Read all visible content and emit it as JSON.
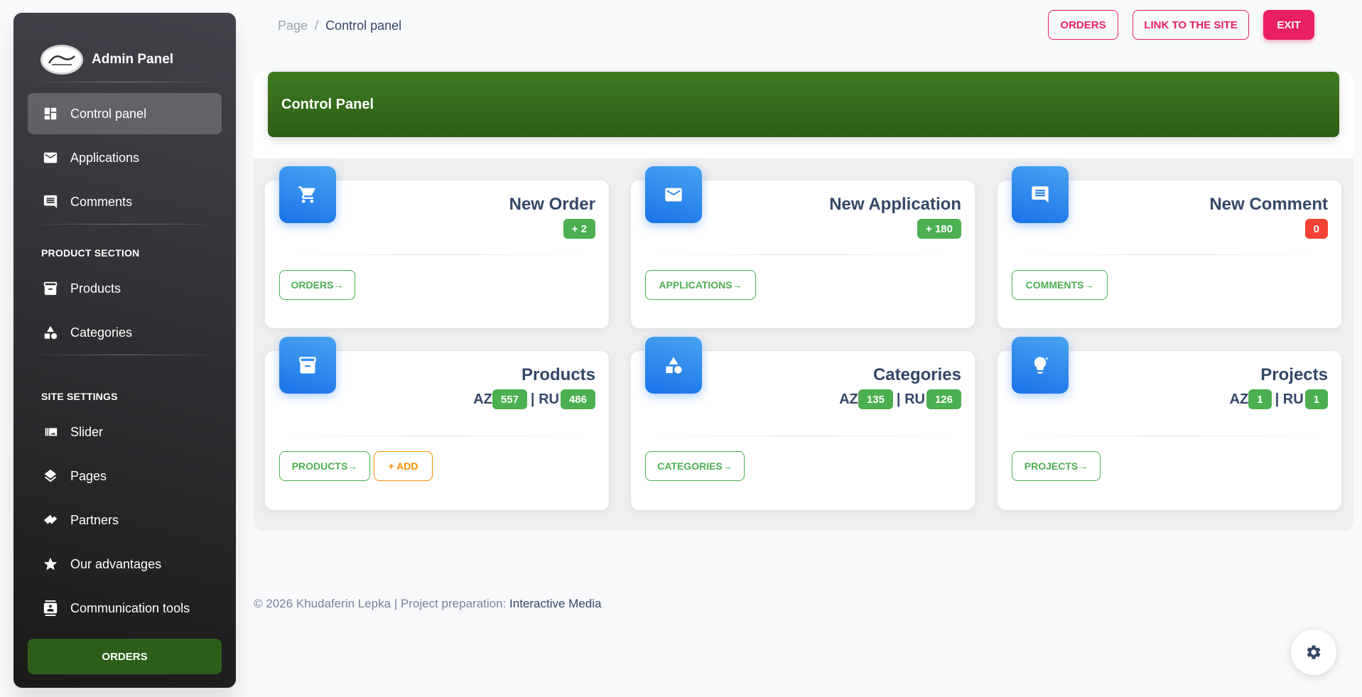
{
  "sidebar": {
    "brand": "Admin Panel",
    "items": [
      {
        "label": "Control panel",
        "icon": "dashboard-icon"
      },
      {
        "label": "Applications",
        "icon": "mail-icon"
      },
      {
        "label": "Comments",
        "icon": "comment-icon"
      },
      {
        "label": "Products",
        "icon": "archive-icon"
      },
      {
        "label": "Categories",
        "icon": "category-icon"
      },
      {
        "label": "Slider",
        "icon": "slider-icon"
      },
      {
        "label": "Pages",
        "icon": "layers-icon"
      },
      {
        "label": "Partners",
        "icon": "handshake-icon"
      },
      {
        "label": "Our advantages",
        "icon": "star-icon"
      },
      {
        "label": "Communication tools",
        "icon": "contact-icon"
      }
    ],
    "sections": [
      "PRODUCT SECTION",
      "SITE SETTINGS"
    ],
    "bottom_button": "ORDERS"
  },
  "breadcrumb": {
    "root": "Page",
    "separator": "/",
    "current": "Control panel"
  },
  "topbar": {
    "orders": "ORDERS",
    "link_site": "LINK TO THE SITE",
    "exit": "EXIT"
  },
  "header": {
    "title": "Control Panel"
  },
  "cards": [
    {
      "title": "New Order",
      "badge": "+ 2",
      "button": "ORDERS→",
      "icon": "cart-icon"
    },
    {
      "title": "New Application",
      "badge": "+ 180",
      "button": "APPLICATIONS→",
      "icon": "mail-icon"
    },
    {
      "title": "New Comment",
      "badge": "0",
      "button": "COMMENTS→",
      "icon": "comment-icon"
    },
    {
      "title": "Products",
      "az_label": "AZ",
      "az": "557",
      "sep": "| RU",
      "ru": "486",
      "button": "PRODUCTS→",
      "button2": "+ ADD",
      "icon": "archive-icon"
    },
    {
      "title": "Categories",
      "az_label": "AZ",
      "az": "135",
      "sep": "| RU",
      "ru": "126",
      "button": "CATEGORIES→",
      "icon": "category-icon"
    },
    {
      "title": "Projects",
      "az_label": "AZ",
      "az": "1",
      "sep": "| RU",
      "ru": "1",
      "button": "PROJECTS→",
      "icon": "lightbulb-icon"
    }
  ],
  "footer": {
    "text": "© 2026 Khudaferin Lepka | Project preparation: ",
    "link": "Interactive Media"
  },
  "colors": {
    "accent": "#e91e63",
    "success": "#4caf50",
    "danger": "#f44335",
    "header": "#3f7a22",
    "icon_bg": "#1a73e8"
  }
}
